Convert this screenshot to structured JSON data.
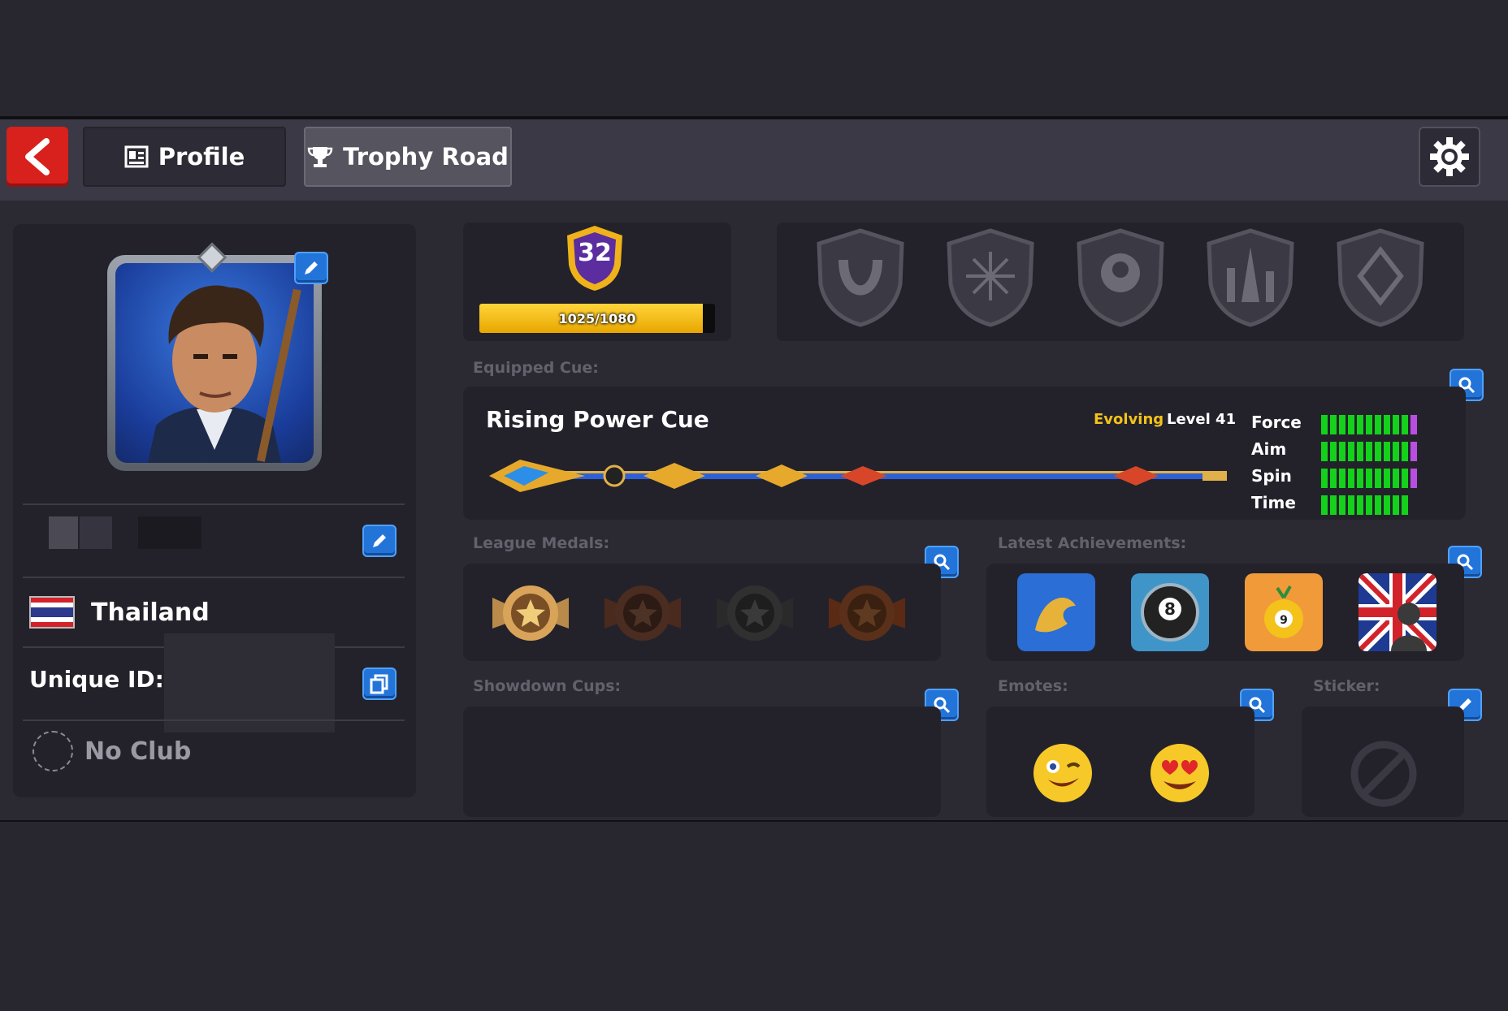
{
  "header": {
    "tabs": [
      {
        "label": "Profile",
        "active": false
      },
      {
        "label": "Trophy Road",
        "active": true
      }
    ]
  },
  "profile": {
    "country": "Thailand",
    "unique_id_label": "Unique ID:",
    "club": "No Club"
  },
  "level": {
    "value": "32",
    "xp_text": "1025/1080",
    "xp_progress": 0.949
  },
  "equipped_cue": {
    "section_label": "Equipped Cue:",
    "name": "Rising Power Cue",
    "evolving_label": "Evolving",
    "level_label": "Level 41",
    "stats": [
      {
        "label": "Force",
        "filled": 10,
        "purple": 1
      },
      {
        "label": "Aim",
        "filled": 10,
        "purple": 1
      },
      {
        "label": "Spin",
        "filled": 10,
        "purple": 1
      },
      {
        "label": "Time",
        "filled": 10,
        "purple": 0
      }
    ]
  },
  "sections": {
    "league_medals": "League Medals:",
    "latest_achievements": "Latest Achievements:",
    "showdown_cups": "Showdown Cups:",
    "emotes": "Emotes:",
    "sticker": "Sticker:"
  },
  "icons": {
    "back": "chevron-left-icon",
    "settings": "gear-icon",
    "search": "magnifier-icon",
    "edit": "pencil-icon",
    "copy": "copy-icon"
  },
  "colors": {
    "accent_blue": "#2374d8",
    "back_red": "#d8201c",
    "stat_green": "#14d11b",
    "evolving_gold": "#f4c21b"
  }
}
